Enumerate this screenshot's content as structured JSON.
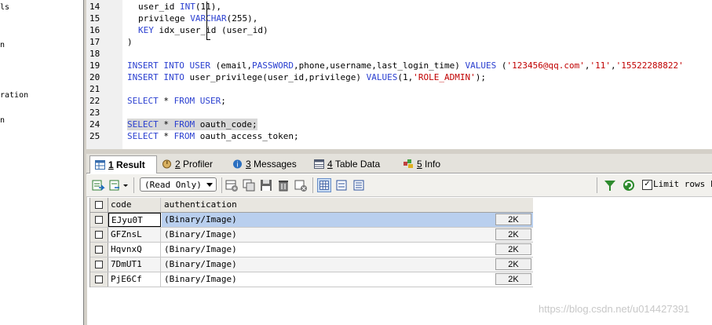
{
  "object_tree": {
    "items": [
      {
        "label": "ls"
      },
      {
        "label": "n"
      },
      {
        "label": "ration"
      },
      {
        "label": "n"
      }
    ]
  },
  "editor": {
    "lines": [
      {
        "num": "14",
        "code": [
          {
            "t": "user_id "
          },
          {
            "t": "INT",
            "k": "kw"
          },
          {
            "t": "(11),"
          }
        ]
      },
      {
        "num": "15",
        "code": [
          {
            "t": "privilege "
          },
          {
            "t": "VARCHAR",
            "k": "kw"
          },
          {
            "t": "(255),"
          }
        ]
      },
      {
        "num": "16",
        "code": [
          {
            "t": "KEY",
            "k": "kw"
          },
          {
            "t": " idx_user_id (user_id)"
          }
        ]
      },
      {
        "num": "17",
        "code": [
          {
            "t": ")"
          }
        ]
      },
      {
        "num": "18",
        "code": []
      },
      {
        "num": "19",
        "code": [
          {
            "t": "INSERT INTO",
            "k": "kw"
          },
          {
            "t": " "
          },
          {
            "t": "USER",
            "k": "kw"
          },
          {
            "t": " (email,"
          },
          {
            "t": "PASSWORD",
            "k": "kw"
          },
          {
            "t": ",phone,username,last_login_time) "
          },
          {
            "t": "VALUES",
            "k": "kw"
          },
          {
            "t": " ("
          },
          {
            "t": "'123456@qq.com'",
            "k": "str"
          },
          {
            "t": ","
          },
          {
            "t": "'11'",
            "k": "str"
          },
          {
            "t": ","
          },
          {
            "t": "'15522288822'",
            "k": "str"
          }
        ]
      },
      {
        "num": "20",
        "code": [
          {
            "t": "INSERT INTO",
            "k": "kw"
          },
          {
            "t": " user_privilege(user_id,privilege) "
          },
          {
            "t": "VALUES",
            "k": "kw"
          },
          {
            "t": "(1,"
          },
          {
            "t": "'ROLE_ADMIN'",
            "k": "str"
          },
          {
            "t": ");"
          }
        ]
      },
      {
        "num": "21",
        "code": []
      },
      {
        "num": "22",
        "code": [
          {
            "t": "SELECT",
            "k": "kw"
          },
          {
            "t": " * "
          },
          {
            "t": "FROM",
            "k": "kw"
          },
          {
            "t": " "
          },
          {
            "t": "USER",
            "k": "kw"
          },
          {
            "t": ";"
          }
        ]
      },
      {
        "num": "23",
        "code": []
      },
      {
        "num": "24",
        "highlight": true,
        "code": [
          {
            "t": "SELECT",
            "k": "kw"
          },
          {
            "t": " * "
          },
          {
            "t": "FROM",
            "k": "kw"
          },
          {
            "t": " oauth_code;"
          }
        ]
      },
      {
        "num": "25",
        "code": [
          {
            "t": "SELECT",
            "k": "kw"
          },
          {
            "t": " * "
          },
          {
            "t": "FROM",
            "k": "kw"
          },
          {
            "t": " oauth_access_token;"
          }
        ]
      }
    ]
  },
  "tabs": [
    {
      "num": "1",
      "label": "Result",
      "active": true,
      "icon": "result-grid-icon",
      "color": "#3a6fb0"
    },
    {
      "num": "2",
      "label": "Profiler",
      "icon": "profiler-icon",
      "color": "#7a5a20"
    },
    {
      "num": "3",
      "label": "Messages",
      "icon": "messages-icon",
      "color": "#2a6fc0"
    },
    {
      "num": "4",
      "label": "Table Data",
      "icon": "table-data-icon",
      "color": "#505a70"
    },
    {
      "num": "5",
      "label": "Info",
      "icon": "info-icon",
      "color": "#c04040"
    }
  ],
  "toolbar": {
    "mode_select": "(Read Only)",
    "limit_checked": "✓",
    "limit_label": "Limit rows F",
    "icons": [
      "export-icon",
      "import-icon",
      "insert-row-icon",
      "duplicate-row-icon",
      "save-icon",
      "delete-icon",
      "cancel-icon",
      "grid-view-icon",
      "form-view-icon",
      "text-view-icon",
      "filter-icon",
      "refresh-icon"
    ]
  },
  "grid": {
    "columns": [
      "code",
      "authentication"
    ],
    "rows": [
      {
        "code": "EJyu0T",
        "auth": "(Binary/Image)",
        "size": "2K",
        "selected": true
      },
      {
        "code": "GFZnsL",
        "auth": "(Binary/Image)",
        "size": "2K"
      },
      {
        "code": "HqvnxQ",
        "auth": "(Binary/Image)",
        "size": "2K"
      },
      {
        "code": "7DmUT1",
        "auth": "(Binary/Image)",
        "size": "2K"
      },
      {
        "code": "PjE6Cf",
        "auth": "(Binary/Image)",
        "size": "2K"
      }
    ]
  },
  "watermark": "https://blog.csdn.net/u014427391",
  "colors": {
    "keyword": "#2a3fd0",
    "string": "#c00000",
    "selection": "#b9cfee"
  }
}
